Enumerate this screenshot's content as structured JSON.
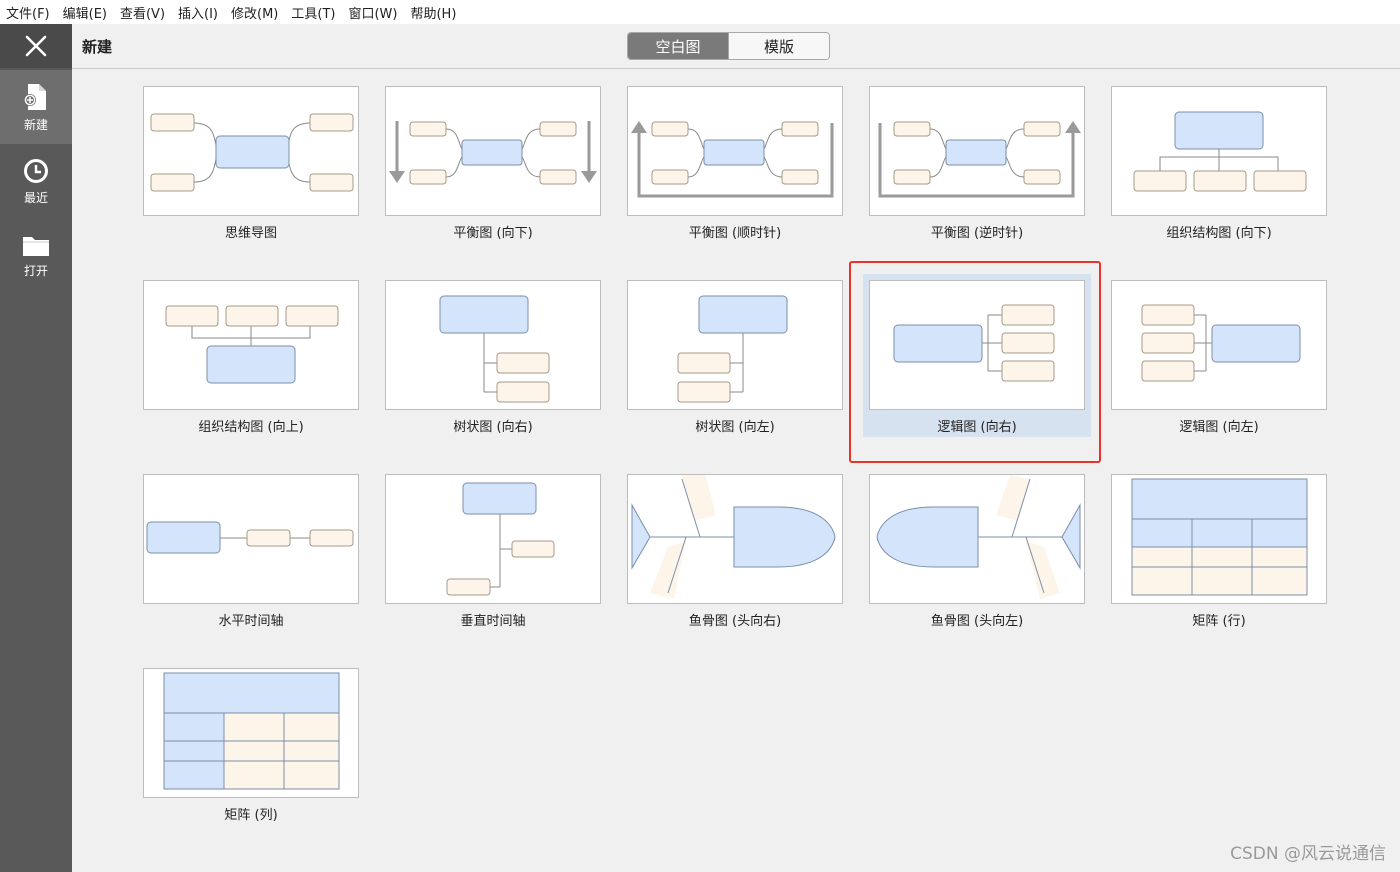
{
  "menu": [
    "文件(F)",
    "编辑(E)",
    "查看(V)",
    "插入(I)",
    "修改(M)",
    "工具(T)",
    "窗口(W)",
    "帮助(H)"
  ],
  "sidebar": {
    "items": [
      {
        "label": "新建",
        "icon": "new-file-icon"
      },
      {
        "label": "最近",
        "icon": "clock-icon"
      },
      {
        "label": "打开",
        "icon": "folder-icon"
      }
    ]
  },
  "header": {
    "title": "新建",
    "tabs": [
      {
        "label": "空白图",
        "active": true
      },
      {
        "label": "模版",
        "active": false
      }
    ]
  },
  "templates": [
    {
      "label": "思维导图"
    },
    {
      "label": "平衡图 (向下)"
    },
    {
      "label": "平衡图 (顺时针)"
    },
    {
      "label": "平衡图 (逆时针)"
    },
    {
      "label": "组织结构图 (向下)"
    },
    {
      "label": "组织结构图 (向上)"
    },
    {
      "label": "树状图 (向右)"
    },
    {
      "label": "树状图 (向左)"
    },
    {
      "label": "逻辑图 (向右)",
      "selected": true
    },
    {
      "label": "逻辑图 (向左)"
    },
    {
      "label": "水平时间轴"
    },
    {
      "label": "垂直时间轴"
    },
    {
      "label": "鱼骨图 (头向右)"
    },
    {
      "label": "鱼骨图 (头向左)"
    },
    {
      "label": "矩阵 (行)"
    },
    {
      "label": "矩阵 (列)"
    }
  ],
  "colors": {
    "main_node": "#d3e4fb",
    "sub_node": "#fdf5e9",
    "selection": "#d6e2ef",
    "highlight_border": "#e8322c"
  },
  "watermark": "CSDN @风云说通信"
}
